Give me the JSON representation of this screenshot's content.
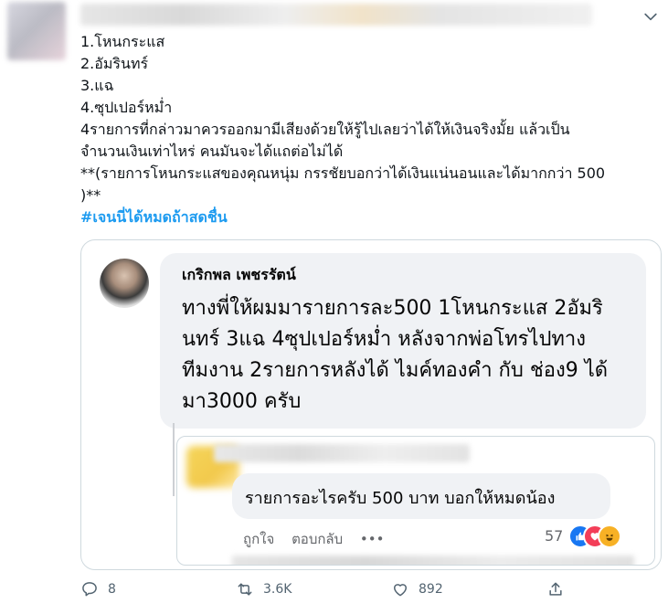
{
  "tweet": {
    "lines": [
      "1.โหนกระแส",
      "2.อัมรินทร์",
      "3.แฉ",
      "4.ซุปเปอร์หม่ำ",
      "4รายการที่กล่าวมาควรออกมามีเสียงด้วยให้รู้ไปเลยว่าได้ให้เงินจริงมั้ย แล้วเป็น",
      "จำนวนเงินเท่าไหร่ คนมันจะได้แถต่อไม่ได้",
      "**(รายการโหนกระแสของคุณหนุ่ม กรรชัยบอกว่าได้เงินแน่นอนและได้มากกว่า 500",
      ")**"
    ],
    "hashtag": "#เจนนี่ได้หมดถ้าสดชื่น"
  },
  "quote": {
    "author": "เกริกพล เพชรรัตน์",
    "comment_lines": [
      "ทางพี่ให้ผมมารายการละ500 1โหนกระแส 2อัมริ",
      "นทร์ 3แฉ 4ซุปเปอร์หม่ำ หลังจากพ่อโทรไปทาง",
      "ทีมงาน 2รายการหลังได้ ไมค์ทองคำ กับ ช่อง9 ได้",
      "มา3000 ครับ"
    ],
    "reply": {
      "text": "รายการอะไรครับ 500 บาท บอกให้หมดน้อง",
      "like_label": "ถูกใจ",
      "reply_label": "ตอบกลับ",
      "more_label": "•••",
      "reaction_count": "57"
    }
  },
  "actions": {
    "reply_count": "8",
    "retweet_count": "3.6K",
    "like_count": "892"
  },
  "colors": {
    "accent": "#1d9bf0",
    "icon_gray": "#536471",
    "fb_like_blue": "#1877f2",
    "fb_love_red": "#f33e58",
    "fb_haha_yellow": "#f7b125"
  }
}
